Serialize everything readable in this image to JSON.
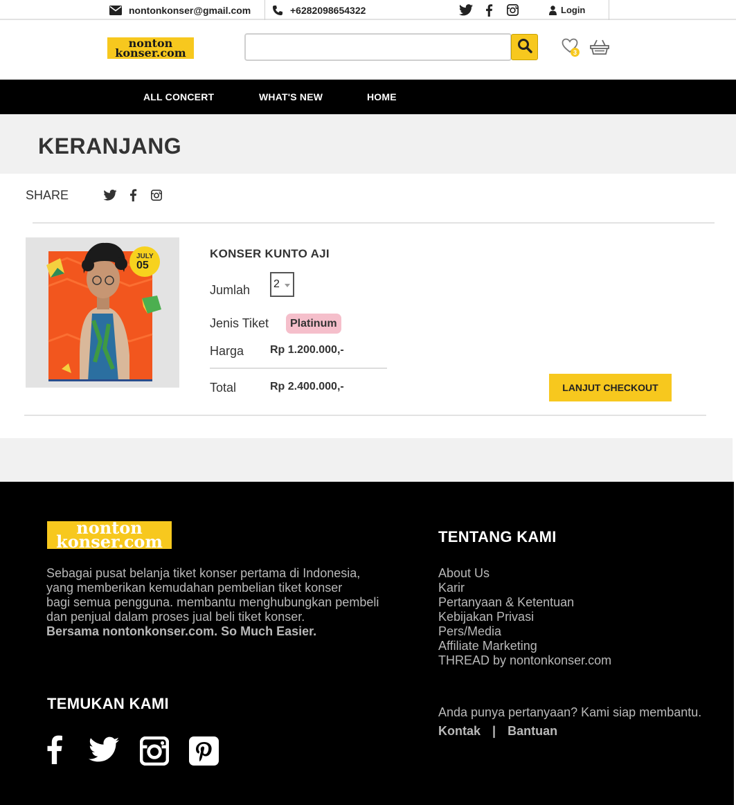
{
  "topbar": {
    "email": "nontonkonser@gmail.com",
    "phone": "+6282098654322",
    "login": "Login"
  },
  "header": {
    "logo_line1": "nonton",
    "logo_line2": "konser.com",
    "search_placeholder": "",
    "wishlist_count": "3"
  },
  "nav": {
    "items": [
      "ALL CONCERT",
      "WHAT'S NEW",
      "HOME"
    ]
  },
  "page": {
    "title": "KERANJANG",
    "share_label": "SHARE"
  },
  "cart_item": {
    "name": "KONSER KUNTO AJI",
    "poster_month": "JULY",
    "poster_day": "05",
    "qty_label": "Jumlah",
    "qty_value": "2",
    "type_label": "Jenis Tiket",
    "type_value": "Platinum",
    "price_label": "Harga",
    "price_value": "Rp 1.200.000,-",
    "total_label": "Total",
    "total_value": "Rp 2.400.000,-",
    "checkout_label": "LANJUT CHECKOUT"
  },
  "footer": {
    "logo_line1": "nonton",
    "logo_line2": "konser.com",
    "desc_line1": "Sebagai pusat belanja tiket konser pertama di Indonesia,",
    "desc_line2": "yang memberikan kemudahan pembelian tiket konser",
    "desc_line3": "bagi semua pengguna. membantu menghubungkan pembeli",
    "desc_line4": "dan penjual dalam proses jual beli tiket konser.",
    "desc_strong": "Bersama nontonkonser.com. So Much Easier.",
    "about_heading": "TENTANG KAMI",
    "links": [
      "About Us",
      "Karir",
      "Pertanyaan & Ketentuan",
      "Kebijakan Privasi",
      "Pers/Media",
      "Affiliate Marketing",
      "THREAD by nontonkonser.com"
    ],
    "find_heading": "TEMUKAN KAMI",
    "question": "Anda punya pertanyaan? Kami siap membantu.",
    "contact": "Kontak",
    "help": "Bantuan",
    "divider": "|"
  },
  "colors": {
    "accent": "#f7c81e",
    "nav_bg": "#000000",
    "badge_bg": "#f5bfcb",
    "band_bg": "#f1f1f1"
  },
  "icons": [
    "envelope-icon",
    "phone-icon",
    "twitter-icon",
    "facebook-icon",
    "instagram-icon",
    "user-icon",
    "search-icon",
    "heart-icon",
    "basket-icon",
    "pinterest-icon"
  ]
}
